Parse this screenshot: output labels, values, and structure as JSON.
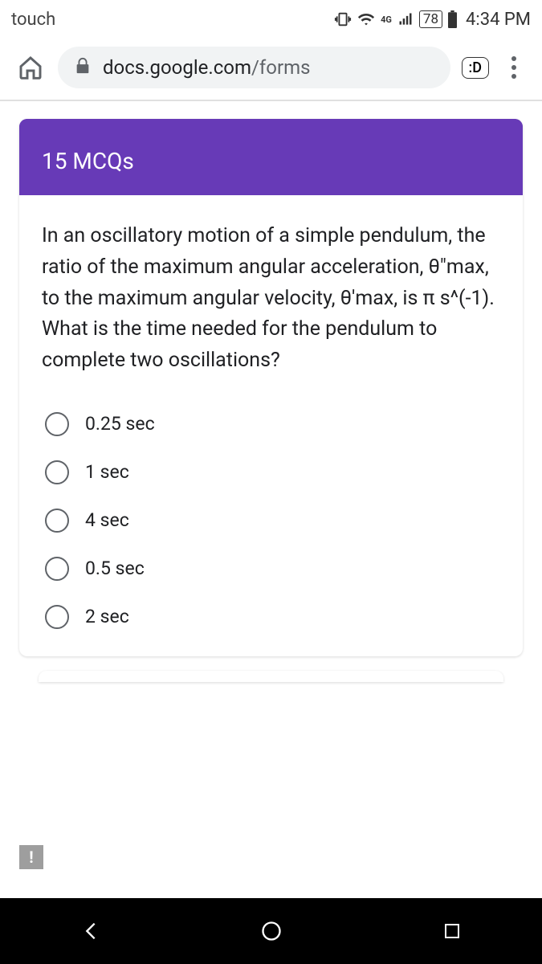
{
  "status": {
    "left_label": "touch",
    "battery": "78",
    "time": "4:34 PM",
    "network": "4G"
  },
  "browser": {
    "url_host": "docs.google.com",
    "url_path": "/forms",
    "badge": ":D"
  },
  "form": {
    "header_title": "15 MCQs",
    "question": "In an oscillatory motion of a simple pendulum, the ratio of the maximum angular acceleration, θ\"max, to the maximum angular velocity, θ'max, is π s^(-1). What is the time needed for the pendulum to complete two oscillations?",
    "options": [
      {
        "label": "0.25 sec"
      },
      {
        "label": "1 sec"
      },
      {
        "label": "4 sec"
      },
      {
        "label": "0.5 sec"
      },
      {
        "label": "2 sec"
      }
    ]
  },
  "alert": "!"
}
